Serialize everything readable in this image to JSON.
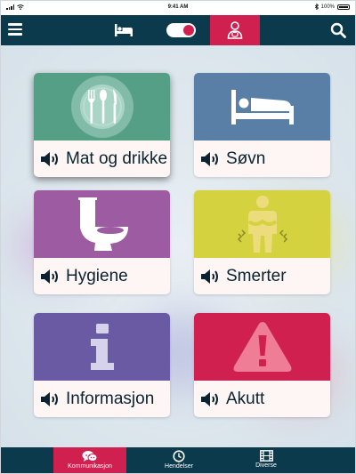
{
  "status_bar": {
    "time": "9:41 AM",
    "battery": "100%"
  },
  "top_nav": {
    "menu_icon": "hamburger-menu-icon",
    "bed_icon": "bed-icon",
    "toggle_state": "on",
    "doctor_icon": "doctor-icon",
    "search_icon": "search-icon"
  },
  "cards": [
    {
      "label": "Mat og drikke",
      "icon": "utensils-icon",
      "color": "#559f86",
      "selected": true
    },
    {
      "label": "Søvn",
      "icon": "bed-icon",
      "color": "#5a7fa7",
      "selected": false
    },
    {
      "label": "Hygiene",
      "icon": "toilet-icon",
      "color": "#9d5ba2",
      "selected": false
    },
    {
      "label": "Smerter",
      "icon": "pain-icon",
      "color": "#d5d23f",
      "selected": false
    },
    {
      "label": "Informasjon",
      "icon": "info-icon",
      "color": "#6a5aa3",
      "selected": false
    },
    {
      "label": "Akutt",
      "icon": "warning-icon",
      "color": "#d0204f",
      "selected": false
    }
  ],
  "tabs": [
    {
      "label": "Kommunikasjon",
      "icon": "chat-icon",
      "active": true
    },
    {
      "label": "Hendelser",
      "icon": "clock-icon",
      "active": false
    },
    {
      "label": "Diverse",
      "icon": "film-icon",
      "active": false
    }
  ],
  "colors": {
    "nav": "#0b3a4d",
    "accent": "#d0204f",
    "card_bottom": "#fdf6f4"
  }
}
